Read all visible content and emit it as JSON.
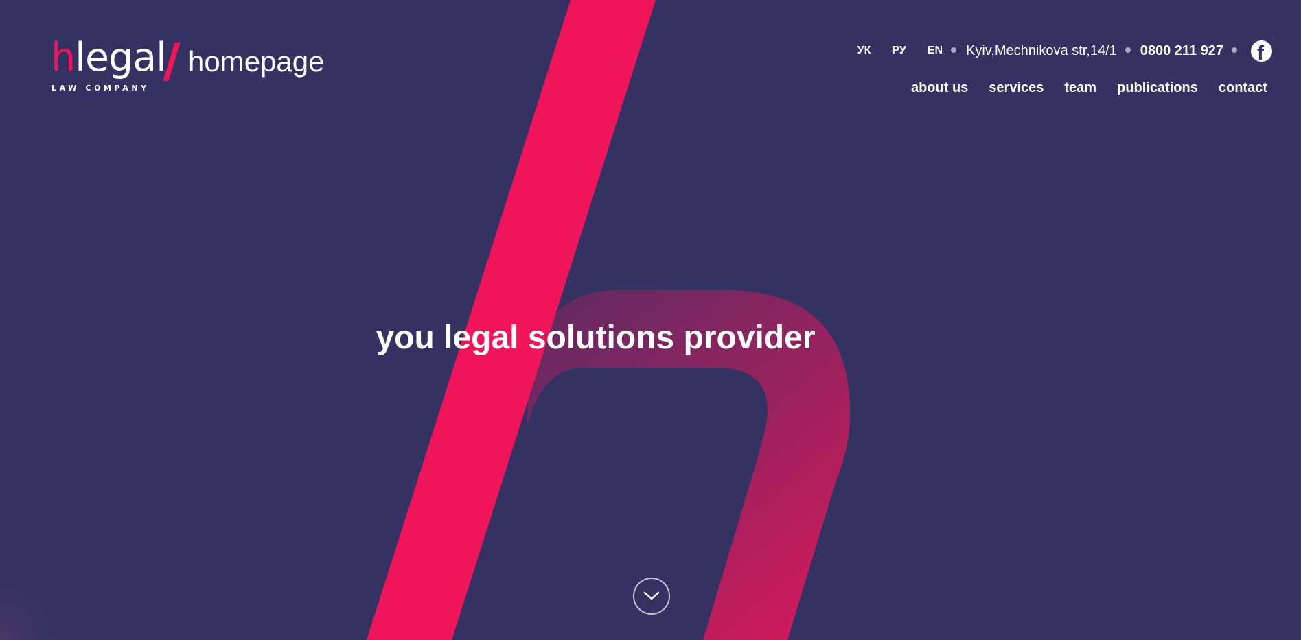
{
  "logo": {
    "first_letter": "h",
    "rest": "legal",
    "tagline": "LAW COMPANY",
    "page_label": "homepage"
  },
  "topbar": {
    "languages": [
      "УК",
      "РУ",
      "EN"
    ],
    "address": "Kyiv,Mechnikova str,14/1",
    "phone": "0800 211 927",
    "social_icon": "facebook-icon"
  },
  "nav": {
    "items": [
      "about us",
      "services",
      "team",
      "publications",
      "contact"
    ]
  },
  "hero": {
    "heading": "you legal solutions provider",
    "scroll_icon": "chevron-down-icon"
  },
  "colors": {
    "background": "#333263",
    "accent": "#f0155b",
    "text": "#ffffff"
  }
}
